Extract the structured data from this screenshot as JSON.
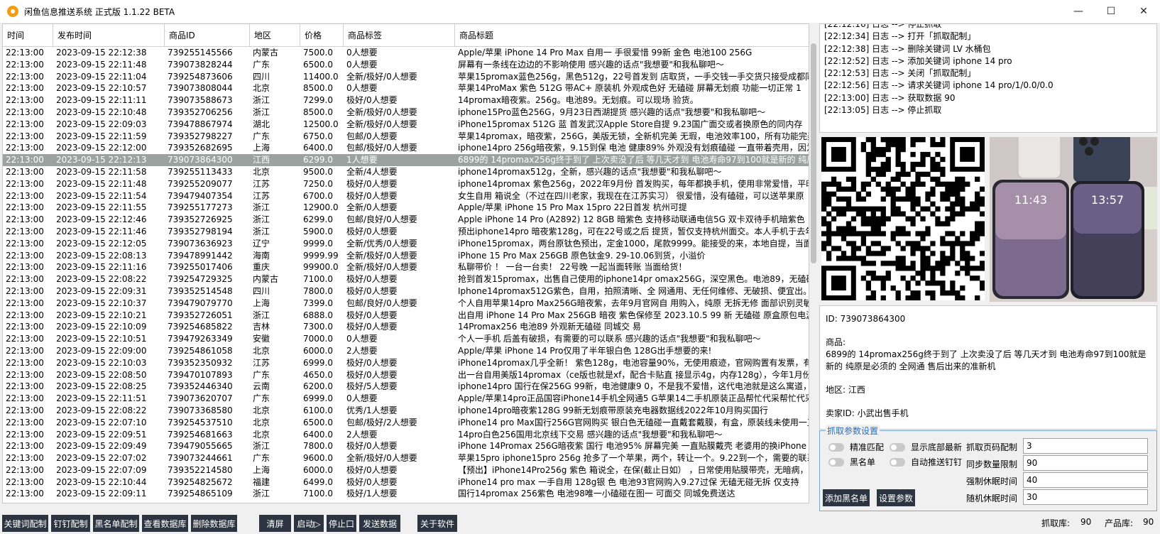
{
  "window": {
    "title": "闲鱼信息推送系统 正式版 1.1.22 BETA",
    "minimize": "—",
    "maximize": "☐",
    "close": "✕"
  },
  "table": {
    "headers": [
      "时间",
      "发布时间",
      "商品ID",
      "地区",
      "价格",
      "商品标签",
      "商品标题"
    ],
    "selected_index": 9,
    "rows": [
      [
        "22:13:00",
        "2023-09-15 22:12:38",
        "739255145566",
        "内蒙古",
        "7500.0",
        "0人想要",
        "Apple/苹果 iPhone 14 Pro Max 自用一 手很爱惜   99新    金色   电池100    256G"
      ],
      [
        "22:13:00",
        "2023-09-15 22:11:48",
        "739073828244",
        "广东",
        "6500.0",
        "0人想要",
        "屏幕有一条线在边边的不影响使用 感兴趣的话点\"我想要\"和我私聊吧～"
      ],
      [
        "22:13:00",
        "2023-09-15 22:11:04",
        "739254873606",
        "四川",
        "11400.0",
        "全新/极好/0人想要",
        "苹果15promax蓝色256g，黑色512g，22号首发到 店取货，一手交钱一手交货只接受成都同"
      ],
      [
        "22:13:00",
        "2023-09-15 22:10:57",
        "739073808044",
        "北京",
        "8500.0",
        "0人想要",
        "苹果14ProMax  紫色  512G 带AC+  原装机 外观成色好 无磕碰 屏幕无划痕 功能一切正常  1"
      ],
      [
        "22:13:00",
        "2023-09-15 22:11:11",
        "739073588673",
        "浙江",
        "7299.0",
        "极好/0人想要",
        "14promax暗夜紫。256g。电池89。无划痕。可以现场 验货。"
      ],
      [
        "22:13:00",
        "2023-09-15 22:10:48",
        "739352706256",
        "浙江",
        "8500.0",
        "全新/极好/0人想要",
        "iphone15Pro蓝色256G，9月23日西湖提货 感兴趣的话点\"我想要\"和我私聊吧～"
      ],
      [
        "22:13:00",
        "2023-09-15 22:09:03",
        "739478867974",
        "湖北",
        "12500.0",
        "全新/极好/0人想要",
        "iPhone15promax 512G 蓝 首发武汉Apple Store自提 9.23国广面交或者换原色的同内存"
      ],
      [
        "22:13:00",
        "2023-09-15 22:11:59",
        "739352798227",
        "广东",
        "6750.0",
        "包邮/0人想要",
        "苹果14promax，暗夜紫，256G，美版无锁，全新机完美 无瑕，电池效率100，所有功能完美"
      ],
      [
        "22:13:00",
        "2023-09-15 22:12:00",
        "739352682695",
        "上海",
        "6400.0",
        "包邮/极好/0人想要",
        "iphone14pro 256g暗夜紫，9.15到保 电池 健康89% 外观没有划痕磕碰 一直带着壳用，因为"
      ],
      [
        "22:13:00",
        "2023-09-15 22:12:13",
        "739073864300",
        "江西",
        "6299.0",
        "1人想要",
        "6899的 14promax256g终于到了 上次卖没了后 等几天才到 电池寿命97到100就是新的 纯原"
      ],
      [
        "22:13:00",
        "2023-09-15 22:11:58",
        "739255113433",
        "北京",
        "9500.0",
        "全新/4人想要",
        "iphone14promax512g，全新，感兴趣的话点\"我想要\"和我私聊吧～"
      ],
      [
        "22:13:00",
        "2023-09-15 22:11:48",
        "739255209077",
        "江苏",
        "7250.0",
        "极好/0人想要",
        "iphone14promax 紫色256g，2022年9月份 首发购买，每年都换手机，使用非常爱惜，平时"
      ],
      [
        "22:13:00",
        "2023-09-15 22:11:54",
        "739479407354",
        "江苏",
        "6700.0",
        "极好/0人想要",
        "女生自用   箱说全（不过在四川老家，我现在在江苏实习） 很爱惜，没有磕碰，可以送苹果原"
      ],
      [
        "22:13:00",
        "2023-09-15 22:11:55",
        "739255177273",
        "浙江",
        "12900.0",
        "全新/0人想要",
        "Apple/苹果 iPhone 15 Pro Max 15pro      22日首发 杭州可提"
      ],
      [
        "22:13:00",
        "2023-09-15 22:12:46",
        "739352726925",
        "浙江",
        "6299.0",
        "包邮/良好/0人想要",
        "Apple iPhone 14 Pro (A2892) 12 8GB 暗紫色 支持移动联通电信5G 双卡双待手机暗紫色 1"
      ],
      [
        "22:13:00",
        "2023-09-15 22:11:46",
        "739352798194",
        "浙江",
        "5900.0",
        "极好/0人想要",
        "预出iphone14pro 暗夜紫128g，可在22号或之后 提货，暂仅支持杭州面交。本人手机于去年"
      ],
      [
        "22:13:00",
        "2023-09-15 22:12:05",
        "739073636923",
        "辽宁",
        "9999.0",
        "全新/优秀/0人想要",
        "iPhone15promax，两台原钛色预出，定金1000，尾款9999。能接受的来，本地自提，当面"
      ],
      [
        "22:13:00",
        "2023-09-15 22:08:13",
        "739478991442",
        "海南",
        "9999.99",
        "全新/极好/0人想要",
        "iPhone 15 Pro Max 256GB 原色钛金9. 29-10.06到货，小溢价"
      ],
      [
        "22:13:00",
        "2023-09-15 22:11:16",
        "739255017406",
        "重庆",
        "99900.0",
        "全新/极好/0人想要",
        "私聊带价 ！ 一台一台卖！ 22号晚 一起当面转账 当面给货！"
      ],
      [
        "22:13:00",
        "2023-09-15 22:08:22",
        "739254729325",
        "内蒙古",
        "7100.0",
        "极好/0人想要",
        "抢到首发15promax，出售自己使用的iphone14pr omax256G，深空黑色。电池89，无磕碰"
      ],
      [
        "22:13:00",
        "2023-09-15 22:09:31",
        "739352514548",
        "四川",
        "7800.0",
        "极好/0人想要",
        "Iphone14promax512G紫色，自用，拍照清晰、全 网通用、无任何维修、无破损、便宜出。"
      ],
      [
        "22:13:00",
        "2023-09-15 22:10:37",
        "739479079770",
        "上海",
        "7399.0",
        "包邮/良好/0人想要",
        "个人自用苹果14pro Max256G暗夜紫，去年9月官网自 用购入，纯原 无拆无修  面部识别灵敏"
      ],
      [
        "22:13:00",
        "2023-09-15 22:10:21",
        "739352726051",
        "浙江",
        "6888.0",
        "极好/0人想要",
        "出自用 iPhone 14 Pro Max 256GB 暗夜 紫色保修至 2023.10.5  99 新 无磕碰  原盒原包电源"
      ],
      [
        "22:13:00",
        "2023-09-15 22:10:09",
        "739254685822",
        "吉林",
        "7300.0",
        "极好/0人想要",
        "14Promax256  电池89  外观新无磕碰  同城交 易"
      ],
      [
        "22:13:00",
        "2023-09-15 22:10:51",
        "739479263349",
        "安徽",
        "7000.0",
        "0人想要",
        "个人一手机 后盖有破损，有需要的可以联系 感兴趣的话点\"我想要\"和我私聊吧～"
      ],
      [
        "22:13:00",
        "2023-09-15 22:09:00",
        "739254861058",
        "北京",
        "6000.0",
        "2人想要",
        "Apple/苹果 iPhone 14 Pro仅用了半年银白色 128G出手想要的来!"
      ],
      [
        "22:13:00",
        "2023-09-15 22:10:03",
        "739352350932",
        "江苏",
        "6999.0",
        "极好/0人想要",
        "iPhone14promax几乎全新！ 紫色128g，电池容量90%，无使用痕迹，官网购置有发票，有"
      ],
      [
        "22:13:00",
        "2023-09-15 22:08:50",
        "739470107893",
        "广东",
        "4650.0",
        "极好/0人想要",
        "出一台自用美版14promax（ce版也就是xf，配合卡贴直 接显示4g，内存128g），今年1月份"
      ],
      [
        "22:13:00",
        "2023-09-15 22:08:25",
        "739352446340",
        "云南",
        "6200.0",
        "极好/5人想要",
        "iphone14pro 国行在保256G 99新，电池健康9 0，不是我不爱惜，这代电池就是这么寓道，"
      ],
      [
        "22:13:00",
        "2023-09-15 22:11:51",
        "739073620707",
        "广东",
        "6999.0",
        "0人想要",
        "Apple/苹果14pro正品国容iPhone14手机全网通5 G苹果14二手机原装正品帮忙代采帮忙代采"
      ],
      [
        "22:13:00",
        "2023-09-15 22:08:22",
        "739073368580",
        "北京",
        "6100.0",
        "优秀/1人想要",
        "iphone14pro暗夜紫128G 99新无划痕带原装充电器数据线2022年10月购买国行"
      ],
      [
        "22:13:00",
        "2023-09-15 22:07:10",
        "739254537510",
        "北京",
        "6500.0",
        "包邮/极好/2人想要",
        "iPhone14 pro Max国行256G官网购买 银白色无磕碰一直戴套戴膜，有盒，原装线未使用一直"
      ],
      [
        "22:13:00",
        "2023-09-15 22:09:51",
        "739254681663",
        "北京",
        "6400.0",
        "2人想要",
        "14pro白色256国用北京线下交易 感兴趣的话点\"我想要\"和我私聊吧～"
      ],
      [
        "22:13:00",
        "2023-09-15 22:09:49",
        "739479055665",
        "浙江",
        "7800.0",
        "极好/0人想要",
        "iPhone 14Promax 256G暗夜紫 国行 电池95% 屏幕完美 一直贴膜戴壳 老婆用的换iPhone 1"
      ],
      [
        "22:13:00",
        "2023-09-15 22:07:02",
        "739073244661",
        "广东",
        "9600.0",
        "全新/极好/0人想要",
        "苹果15pro iphone15pro 256g 抢多了一个苹果，两个，转让一个。9.22到一个，需要的联系"
      ],
      [
        "22:13:00",
        "2023-09-15 22:07:09",
        "739352214580",
        "上海",
        "6000.0",
        "极好/0人想要",
        "【预出】iPhone14Pro256g 紫色 箱说全，在保(截止日如） ，日常使用贴膜带壳，无暗病，电"
      ],
      [
        "22:13:00",
        "2023-09-15 22:10:44",
        "739254825672",
        "福建",
        "6499.0",
        "极好/0人想要",
        "iPhone14  pro max  一手自用  128g银 色   电池93官网购入9.27过保  无磕无碰无拆  仅支持"
      ],
      [
        "22:13:00",
        "2023-09-15 22:09:11",
        "739254865109",
        "浙江",
        "7100.0",
        "极好/1人想要",
        "国行14promax 256紫色 电池98唯一小磕碰在图一 可面交  同城免费送达"
      ]
    ]
  },
  "log": {
    "lines": [
      "[22:12:16] 日志 --> 停止抓取",
      "[22:12:34] 日志 --> 打开「抓取配制」",
      "[22:12:38] 日志 --> 删除关键词 LV 水桶包",
      "[22:12:52] 日志 --> 添加关键词 iphone 14 pro",
      "[22:12:53] 日志 --> 关闭「抓取配制」",
      "[22:12:56] 日志 --> 请求关键词 iphone 14 pro/1/0.0/0.0",
      "[22:13:00] 日志 --> 获取数据 90",
      "[22:13:05] 日志 --> 停止抓取"
    ]
  },
  "detail": {
    "id_line": "ID: 739073864300",
    "product_label": "商品:",
    "product_text": "6899的 14promax256g终于到了 上次卖没了后 等几天才到 电池寿命97到100就是新的 纯原是必须的 全网通 售后出来的准新机",
    "region_line": "地区: 江西",
    "seller_line": "卖家ID: 小武出售手机"
  },
  "params": {
    "legend": "抓取参数设置",
    "toggles": {
      "exact": "精准匹配",
      "show_bottom_latest": "显示底部最新",
      "blacklist": "黑名单",
      "auto_push_dingtalk": "自动推送钉钉"
    },
    "fields": [
      {
        "label": "抓取页码配制",
        "value": "3"
      },
      {
        "label": "同步数量限制",
        "value": "90"
      },
      {
        "label": "强制休眠时间",
        "value": "40"
      },
      {
        "label": "随机休眠时间",
        "value": "30"
      }
    ],
    "add_blacklist_button": "添加黑名单",
    "set_params_button": "设置参数"
  },
  "bottom_buttons": [
    "关键词配制",
    "钉钉配制",
    "黑名单配制",
    "查看数据库",
    "删除数据库",
    "清屏",
    "启动▷",
    "停止口",
    "发送数据",
    "关于软件"
  ],
  "status": {
    "crawl_label": "抓取库:",
    "crawl_value": "90",
    "product_label": "产品库:",
    "product_value": "90"
  },
  "colors": {
    "accent": "#2b3440",
    "selected_row": "#9aa3a0",
    "legend_blue": "#2a6fbd"
  }
}
